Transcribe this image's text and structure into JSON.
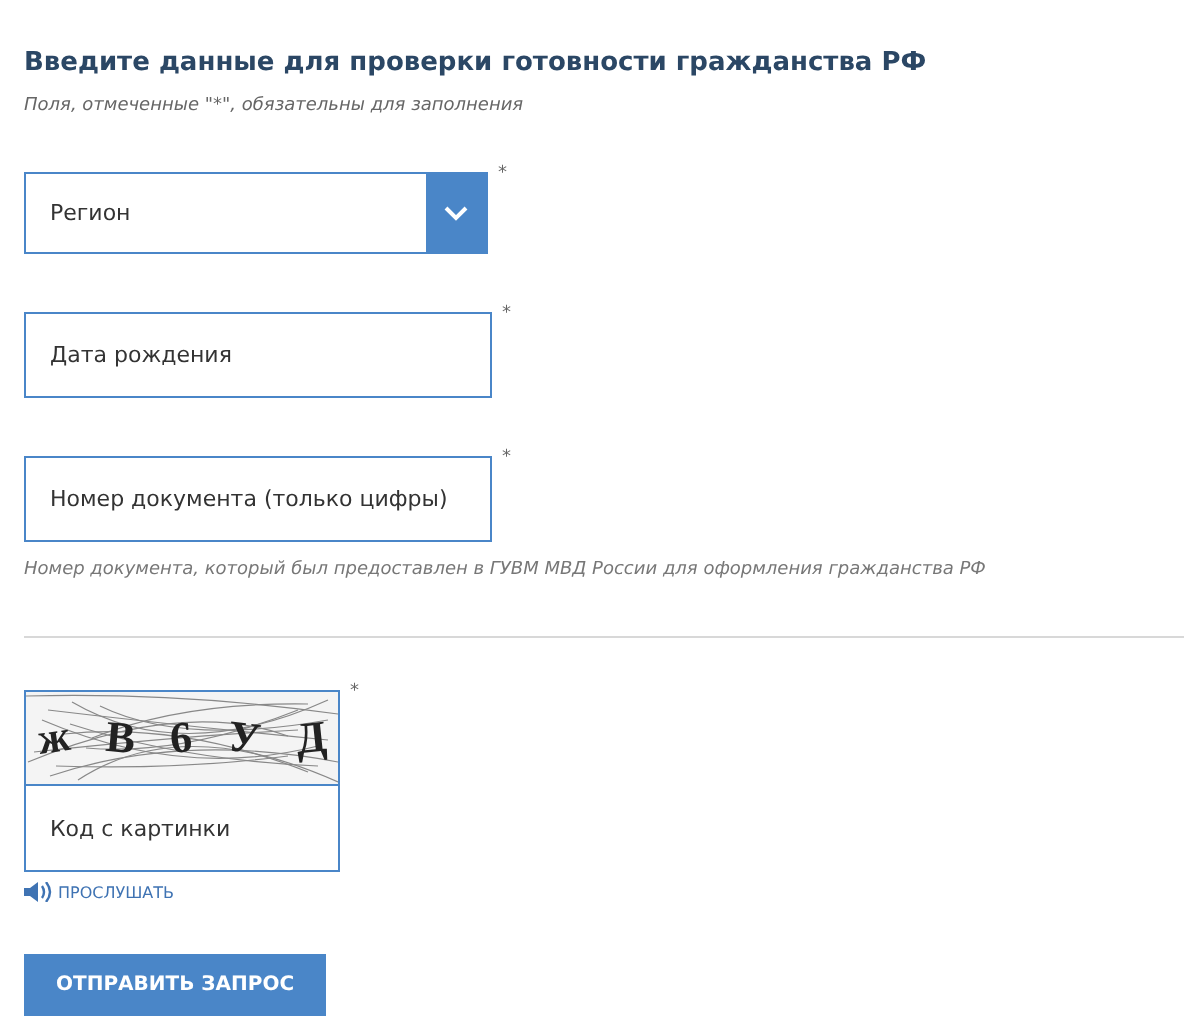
{
  "title": "Введите данные для проверки готовности гражданства РФ",
  "note": "Поля, отмеченные \"*\", обязательны для заполнения",
  "fields": [
    {
      "kind": "select",
      "placeholder": "Регион",
      "required_mark": "*"
    },
    {
      "kind": "text",
      "placeholder": "Дата рождения",
      "required_mark": "*"
    },
    {
      "kind": "text",
      "placeholder": "Номер документа (только цифры)",
      "required_mark": "*",
      "hint": "Номер документа, который был предоставлен в ГУВМ МВД России для оформления гражданства РФ"
    }
  ],
  "captcha": {
    "characters": [
      "ж",
      "В",
      "6",
      "У",
      "Д"
    ],
    "placeholder": "Код с картинки",
    "required_mark": "*",
    "listen_label": "ПРОСЛУШАТЬ"
  },
  "submit_button": "ОТПРАВИТЬ ЗАПРОС"
}
